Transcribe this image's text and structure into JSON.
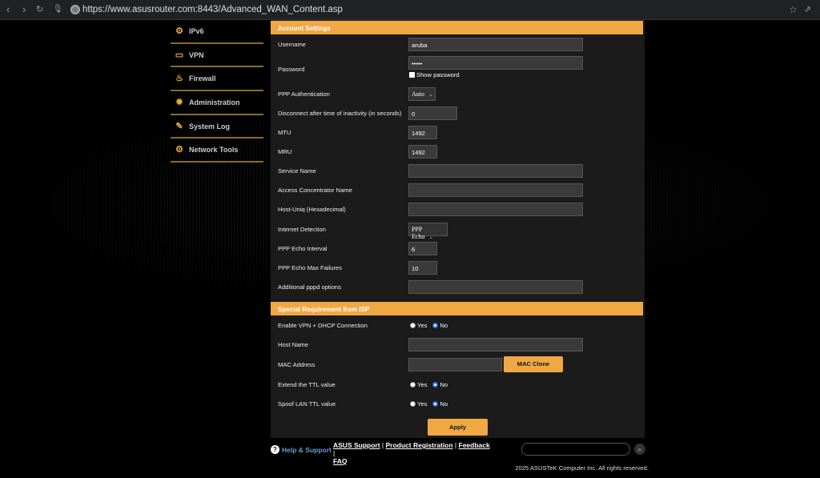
{
  "browser": {
    "url": "https://www.asusrouter.com:8443/Advanced_WAN_Content.asp"
  },
  "sidebar": [
    {
      "label": "IPv6",
      "icon": "ipv6-icon"
    },
    {
      "label": "VPN",
      "icon": "vpn-icon"
    },
    {
      "label": "Firewall",
      "icon": "firewall-icon"
    },
    {
      "label": "Administration",
      "icon": "administration-icon"
    },
    {
      "label": "System Log",
      "icon": "system-log-icon"
    },
    {
      "label": "Network Tools",
      "icon": "network-tools-icon"
    }
  ],
  "account": {
    "title": "Account Settings",
    "rows": [
      {
        "label": "Username",
        "type": "text",
        "value": "aruba"
      },
      {
        "label": "Password",
        "type": "password",
        "value": "•••••",
        "show_label": "Show password"
      },
      {
        "label": "PPP Authentication",
        "type": "select",
        "value": "Auto"
      },
      {
        "label": "Disconnect after time of inactivity (in seconds)",
        "type": "short",
        "value": "0"
      },
      {
        "label": "MTU",
        "type": "tiny",
        "value": "1492"
      },
      {
        "label": "MRU",
        "type": "tiny",
        "value": "1492"
      },
      {
        "label": "Service Name",
        "type": "text",
        "value": ""
      },
      {
        "label": "Access Concentrator Name",
        "type": "text",
        "value": ""
      },
      {
        "label": "Host-Uniq (Hexadecimal)",
        "type": "text",
        "value": ""
      },
      {
        "label": "Internet Detection",
        "type": "select",
        "value": "PPP Echo"
      },
      {
        "label": "PPP Echo Interval",
        "type": "tiny",
        "value": "6"
      },
      {
        "label": "PPP Echo Max Failures",
        "type": "tiny",
        "value": "10"
      },
      {
        "label": "Additional pppd options",
        "type": "text",
        "value": ""
      }
    ]
  },
  "isp": {
    "title": "Special Requirement from ISP",
    "rows": [
      {
        "label": "Enable VPN + DHCP Connection",
        "type": "radio",
        "yes": "Yes",
        "no": "No",
        "selected": "No"
      },
      {
        "label": "Host Name",
        "type": "text",
        "value": ""
      },
      {
        "label": "MAC Address",
        "type": "mac",
        "value": "",
        "button": "MAC Clone"
      },
      {
        "label": "Extend the TTL value",
        "type": "radio",
        "yes": "Yes",
        "no": "No",
        "selected": "No"
      },
      {
        "label": "Spoof LAN TTL value",
        "type": "radio",
        "yes": "Yes",
        "no": "No",
        "selected": "No"
      }
    ]
  },
  "apply": "Apply",
  "footer": {
    "help": "Help & Support",
    "links": [
      "ASUS Support",
      "Product Registration",
      "Feedback",
      "FAQ"
    ],
    "copyright": "2025 ASUSTeK Computer Inc. All rights reserved."
  }
}
